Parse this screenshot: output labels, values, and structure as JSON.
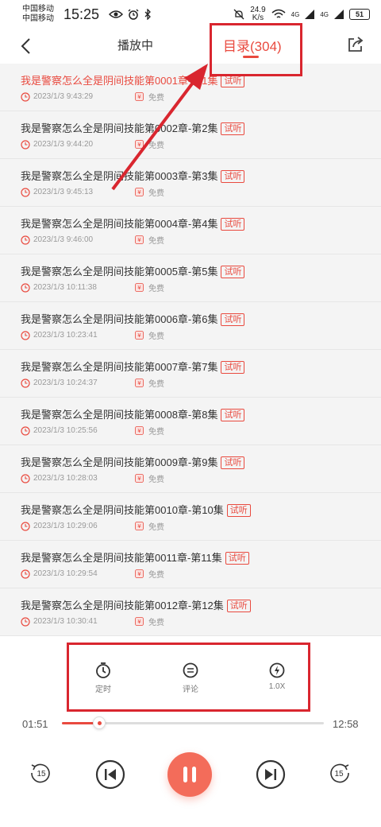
{
  "status_bar": {
    "carrier1": "中国移动",
    "carrier2": "中国移动",
    "time": "15:25",
    "net_speed_value": "24.9",
    "net_speed_unit": "K/s",
    "signal1": "4G",
    "signal2": "4G",
    "battery": "51"
  },
  "header": {
    "tab_playing": "播放中",
    "tab_catalog": "目录(304)"
  },
  "colors": {
    "accent": "#e94a3f",
    "annotation": "#d9262f"
  },
  "episodes": [
    {
      "title": "我是警察怎么全是阴间技能第0001章-第1集",
      "date": "2023/1/3 9:43:29",
      "free": "免费",
      "badge": "试听",
      "active": true
    },
    {
      "title": "我是警察怎么全是阴间技能第0002章-第2集",
      "date": "2023/1/3 9:44:20",
      "free": "免费",
      "badge": "试听"
    },
    {
      "title": "我是警察怎么全是阴间技能第0003章-第3集",
      "date": "2023/1/3 9:45:13",
      "free": "免费",
      "badge": "试听"
    },
    {
      "title": "我是警察怎么全是阴间技能第0004章-第4集",
      "date": "2023/1/3 9:46:00",
      "free": "免费",
      "badge": "试听"
    },
    {
      "title": "我是警察怎么全是阴间技能第0005章-第5集",
      "date": "2023/1/3 10:11:38",
      "free": "免费",
      "badge": "试听"
    },
    {
      "title": "我是警察怎么全是阴间技能第0006章-第6集",
      "date": "2023/1/3 10:23:41",
      "free": "免费",
      "badge": "试听"
    },
    {
      "title": "我是警察怎么全是阴间技能第0007章-第7集",
      "date": "2023/1/3 10:24:37",
      "free": "免费",
      "badge": "试听"
    },
    {
      "title": "我是警察怎么全是阴间技能第0008章-第8集",
      "date": "2023/1/3 10:25:56",
      "free": "免费",
      "badge": "试听"
    },
    {
      "title": "我是警察怎么全是阴间技能第0009章-第9集",
      "date": "2023/1/3 10:28:03",
      "free": "免费",
      "badge": "试听"
    },
    {
      "title": "我是警察怎么全是阴间技能第0010章-第10集",
      "date": "2023/1/3 10:29:06",
      "free": "免费",
      "badge": "试听"
    },
    {
      "title": "我是警察怎么全是阴间技能第0011章-第11集",
      "date": "2023/1/3 10:29:54",
      "free": "免费",
      "badge": "试听"
    },
    {
      "title": "我是警察怎么全是阴间技能第0012章-第12集",
      "date": "2023/1/3 10:30:41",
      "free": "免费",
      "badge": "试听"
    }
  ],
  "controls": {
    "timer_label": "定时",
    "comment_label": "评论",
    "speed_label": "1.0X"
  },
  "player": {
    "current_time": "01:51",
    "total_time": "12:58",
    "progress_fraction": 0.143,
    "skip_back_seconds": "15",
    "skip_forward_seconds": "15"
  }
}
